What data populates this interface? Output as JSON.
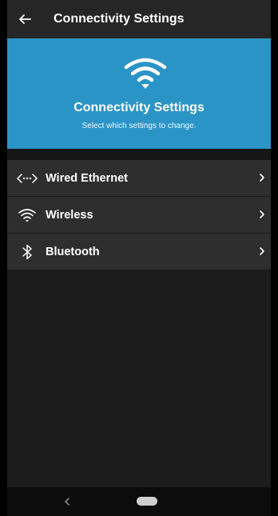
{
  "appbar": {
    "title": "Connectivity Settings",
    "back_icon": "back-arrow-icon"
  },
  "hero": {
    "icon": "wifi-icon",
    "title": "Connectivity Settings",
    "subtitle": "Select which settings to change."
  },
  "items": [
    {
      "label": "Wired Ethernet",
      "icon": "ethernet-icon"
    },
    {
      "label": "Wireless",
      "icon": "wifi-icon"
    },
    {
      "label": "Bluetooth",
      "icon": "bluetooth-icon"
    }
  ],
  "colors": {
    "accent": "#2b94c6",
    "appbar": "#262626",
    "background": "#1c1c1c",
    "row": "#2e2e2e"
  },
  "navbar": {
    "back_icon": "nav-back-icon",
    "home_icon": "nav-home-pill-icon"
  }
}
